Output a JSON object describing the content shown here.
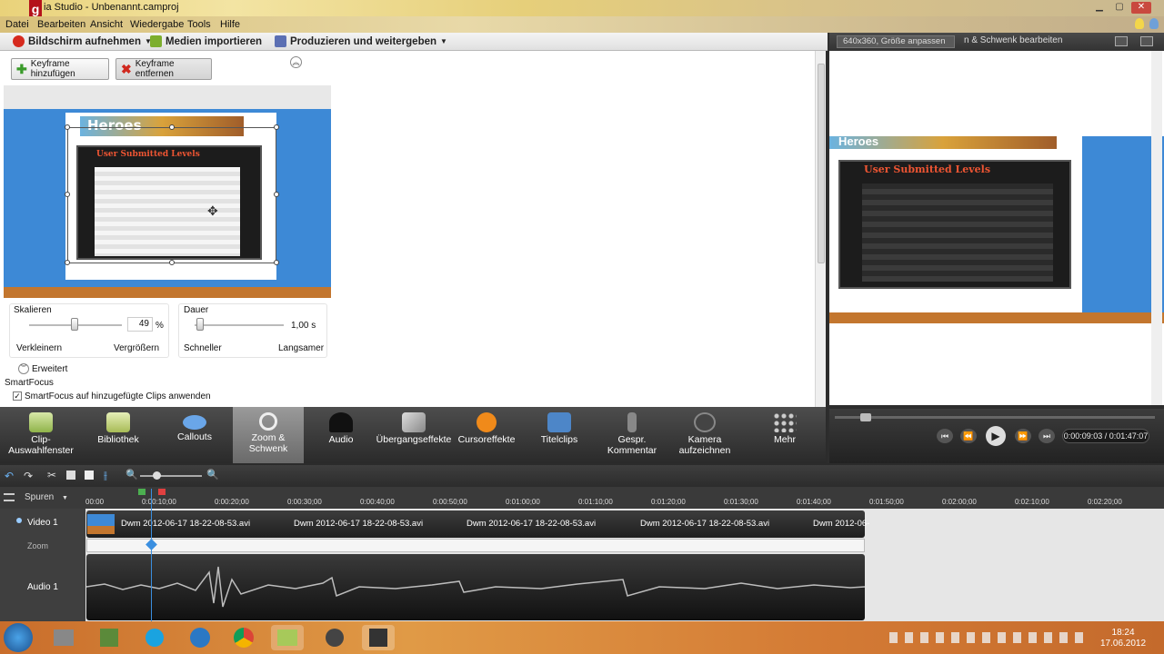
{
  "window": {
    "title": "ia Studio - Unbenannt.camproj",
    "controls": [
      "▁",
      "▢",
      "✕"
    ]
  },
  "menu": [
    "Datei",
    "Bearbeiten",
    "Ansicht",
    "Wiedergabe",
    "Tools",
    "Hilfe"
  ],
  "toolbar": {
    "record": "Bildschirm aufnehmen",
    "import": "Medien importieren",
    "produce": "Produzieren und weitergeben"
  },
  "keyframes": {
    "add": "Keyframe hinzufügen",
    "remove": "Keyframe entfernen"
  },
  "zoom_panel": {
    "scale_label": "Skalieren",
    "scale_value": "49",
    "scale_unit": "%",
    "scale_min": "Verkleinern",
    "scale_max": "Vergrößern",
    "duration_label": "Dauer",
    "duration_value": "1,00 s",
    "duration_min": "Schneller",
    "duration_max": "Langsamer",
    "advanced": "Erweitert",
    "smartfocus": "SmartFocus",
    "smartfocus_check": "SmartFocus auf hinzugefügte Clips anwenden",
    "scale_level": 0.49,
    "duration_level": 0.02
  },
  "screen_content": {
    "levels_title": "User Submitted Levels",
    "logo": "Heroes"
  },
  "tools": [
    {
      "label": "Clip-\nAuswahlfenster",
      "icon": "clip-bin-icon"
    },
    {
      "label": "Bibliothek",
      "icon": "library-icon"
    },
    {
      "label": "Callouts",
      "icon": "callout-icon"
    },
    {
      "label": "Zoom &\nSchwenk",
      "icon": "zoom-pan-icon",
      "active": true
    },
    {
      "label": "Audio",
      "icon": "audio-icon"
    },
    {
      "label": "Übergangseffekte",
      "icon": "transitions-icon"
    },
    {
      "label": "Cursoreffekte",
      "icon": "cursor-effects-icon"
    },
    {
      "label": "Titelclips",
      "icon": "title-clips-icon"
    },
    {
      "label": "Gespr.\nKommentar",
      "icon": "microphone-icon"
    },
    {
      "label": "Kamera\naufzeichnen",
      "icon": "camera-icon"
    },
    {
      "label": "Mehr",
      "icon": "more-icon"
    }
  ],
  "preview": {
    "size_dropdown": "640x360, Größe anpassen",
    "mode_label": "n & Schwenk bearbeiten",
    "time": "0:00:09:03 / 0:01:47:07"
  },
  "timeline": {
    "tracks_label": "Spuren",
    "ticks": [
      "00:00",
      "0:00:10;00",
      "0:00:20;00",
      "0:00:30;00",
      "0:00:40;00",
      "0:00:50;00",
      "0:01:00;00",
      "0:01:10;00",
      "0:01:20;00",
      "0:01:30;00",
      "0:01:40;00",
      "0:01:50;00",
      "0:02:00;00",
      "0:02:10;00",
      "0:02:20;00"
    ],
    "video_track": "Video 1",
    "zoom_track": "Zoom",
    "audio_track": "Audio 1",
    "clips": [
      "Dwm 2012-06-17 18-22-08-53.avi",
      "Dwm 2012-06-17 18-22-08-53.avi",
      "Dwm 2012-06-17 18-22-08-53.avi",
      "Dwm 2012-06-17 18-22-08-53.avi",
      "Dwm 2012-06-"
    ]
  },
  "taskbar": {
    "time": "18:24",
    "date": "17.06.2012"
  },
  "colors": {
    "accent": "#3b8fe0",
    "levels_title": "#ee5533",
    "taskbar": "#d47b35"
  }
}
